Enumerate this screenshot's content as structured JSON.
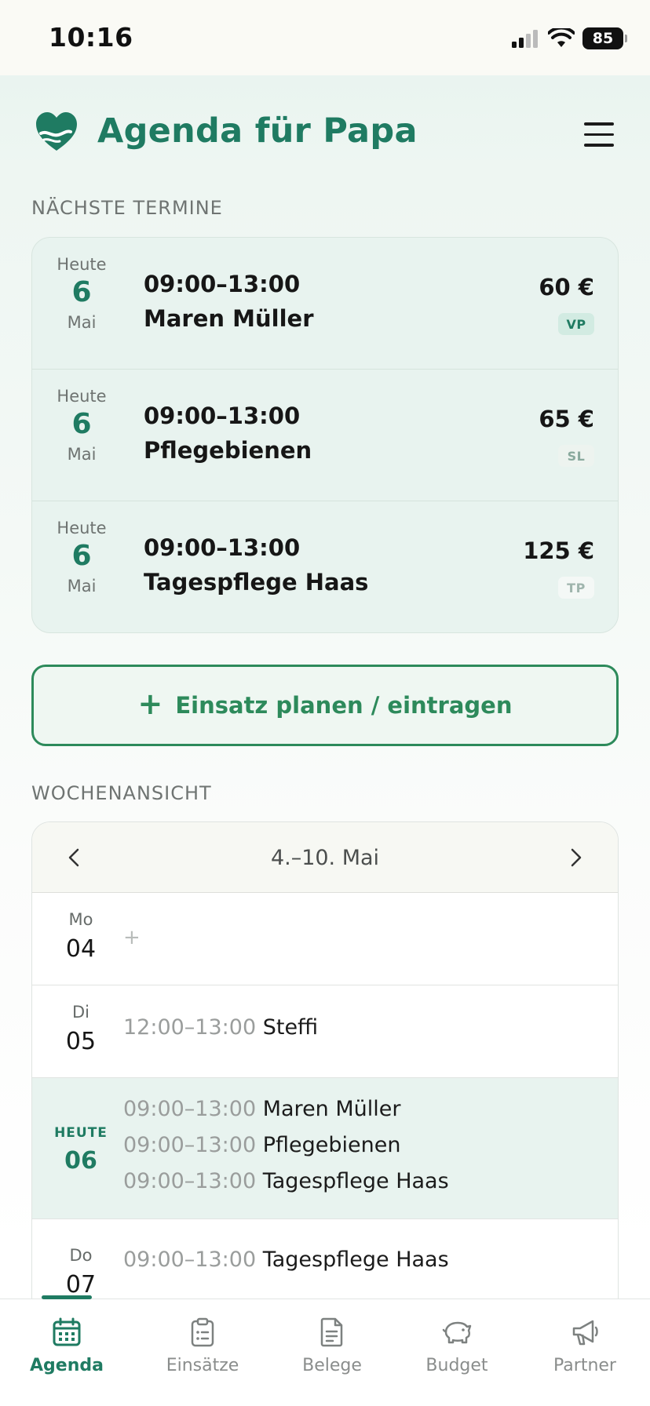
{
  "status_bar": {
    "time": "10:16",
    "battery": "85"
  },
  "header": {
    "title": "Agenda für Papa"
  },
  "upcoming": {
    "section_title": "NÄCHSTE TERMINE",
    "items": [
      {
        "date_label": "Heute",
        "day": "6",
        "month": "Mai",
        "time": "09:00–13:00",
        "name": "Maren Müller",
        "price": "60 €",
        "badge": "VP"
      },
      {
        "date_label": "Heute",
        "day": "6",
        "month": "Mai",
        "time": "09:00–13:00",
        "name": "Pflegebienen",
        "price": "65 €",
        "badge": "SL"
      },
      {
        "date_label": "Heute",
        "day": "6",
        "month": "Mai",
        "time": "09:00–13:00",
        "name": "Tagespflege Haas",
        "price": "125 €",
        "badge": "TP"
      }
    ]
  },
  "add_button": {
    "icon": "+",
    "label": "Einsatz planen / eintragen"
  },
  "week": {
    "section_title": "WOCHENANSICHT",
    "range": "4.–10. Mai",
    "days": [
      {
        "name": "Mo",
        "num": "04",
        "add": "+",
        "entries": []
      },
      {
        "name": "Di",
        "num": "05",
        "entries": [
          {
            "time": "12:00–13:00",
            "name": "Steffi"
          }
        ]
      },
      {
        "name": "HEUTE",
        "num": "06",
        "entries": [
          {
            "time": "09:00–13:00",
            "name": "Maren Müller"
          },
          {
            "time": "09:00–13:00",
            "name": "Pflegebienen"
          },
          {
            "time": "09:00–13:00",
            "name": "Tagespflege Haas"
          }
        ]
      },
      {
        "name": "Do",
        "num": "07",
        "entries": [
          {
            "time": "09:00–13:00",
            "name": "Tagespflege Haas"
          }
        ]
      }
    ]
  },
  "tabs": [
    {
      "label": "Agenda",
      "icon": "calendar-icon",
      "active": true
    },
    {
      "label": "Einsätze",
      "icon": "clipboard-icon"
    },
    {
      "label": "Belege",
      "icon": "document-icon"
    },
    {
      "label": "Budget",
      "icon": "piggy-bank-icon"
    },
    {
      "label": "Partner",
      "icon": "megaphone-icon"
    }
  ],
  "colors": {
    "brand": "#1f7b62",
    "accent_button": "#2d8a5b",
    "today_bg": "#e8f3ef"
  }
}
